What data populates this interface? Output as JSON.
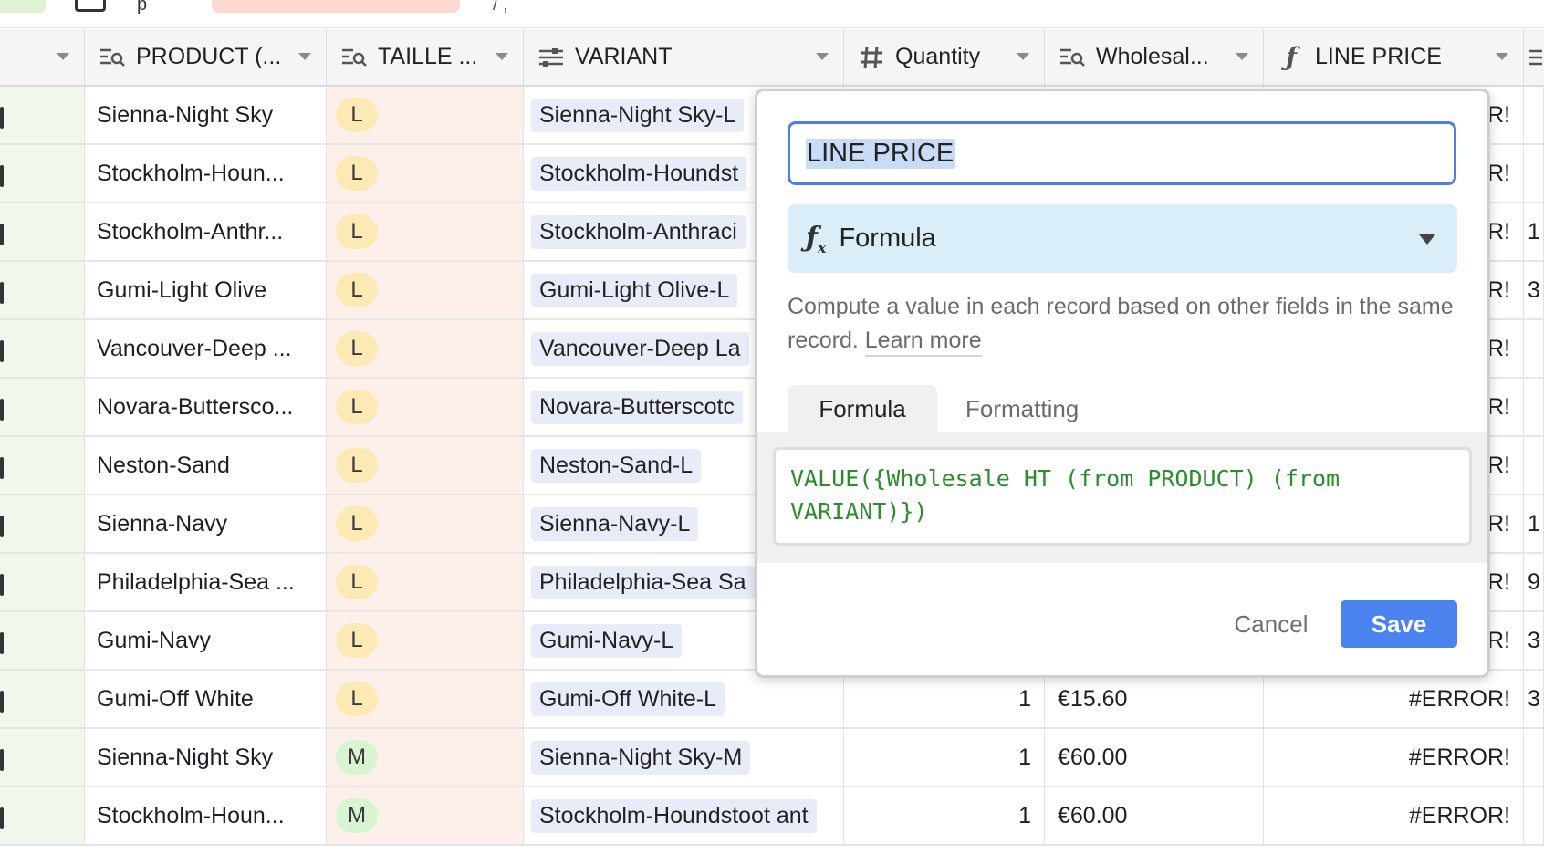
{
  "toolbar": {
    "partial_text_left": "p",
    "partial_text_right": "/ ,"
  },
  "columns": [
    {
      "label": "",
      "icon": ""
    },
    {
      "label": "PRODUCT (...",
      "icon": "lookup-icon"
    },
    {
      "label": "TAILLE ...",
      "icon": "lookup-icon"
    },
    {
      "label": "VARIANT",
      "icon": "link-icon"
    },
    {
      "label": "Quantity",
      "icon": "hash-icon"
    },
    {
      "label": "Wholesal...",
      "icon": "lookup-icon"
    },
    {
      "label": "LINE PRICE",
      "icon": "formula-icon"
    }
  ],
  "rows": [
    {
      "product": "Sienna-Night Sky",
      "size": "L",
      "variant": "Sienna-Night Sky-L",
      "quantity": "",
      "wholesale": "",
      "line_price": "R!",
      "extra": ""
    },
    {
      "product": "Stockholm-Houn...",
      "size": "L",
      "variant": "Stockholm-Houndst",
      "quantity": "",
      "wholesale": "",
      "line_price": "R!",
      "extra": ""
    },
    {
      "product": "Stockholm-Anthr...",
      "size": "L",
      "variant": "Stockholm-Anthraci",
      "quantity": "",
      "wholesale": "",
      "line_price": "R!",
      "extra": "1"
    },
    {
      "product": "Gumi-Light Olive",
      "size": "L",
      "variant": "Gumi-Light Olive-L",
      "quantity": "",
      "wholesale": "",
      "line_price": "R!",
      "extra": "3"
    },
    {
      "product": "Vancouver-Deep ...",
      "size": "L",
      "variant": "Vancouver-Deep La",
      "quantity": "",
      "wholesale": "",
      "line_price": "R!",
      "extra": ""
    },
    {
      "product": "Novara-Buttersco...",
      "size": "L",
      "variant": "Novara-Butterscotc",
      "quantity": "",
      "wholesale": "",
      "line_price": "R!",
      "extra": ""
    },
    {
      "product": "Neston-Sand",
      "size": "L",
      "variant": "Neston-Sand-L",
      "quantity": "",
      "wholesale": "",
      "line_price": "R!",
      "extra": ""
    },
    {
      "product": "Sienna-Navy",
      "size": "L",
      "variant": "Sienna-Navy-L",
      "quantity": "",
      "wholesale": "",
      "line_price": "R!",
      "extra": "1"
    },
    {
      "product": "Philadelphia-Sea ...",
      "size": "L",
      "variant": "Philadelphia-Sea Sa",
      "quantity": "",
      "wholesale": "",
      "line_price": "R!",
      "extra": "9"
    },
    {
      "product": "Gumi-Navy",
      "size": "L",
      "variant": "Gumi-Navy-L",
      "quantity": "",
      "wholesale": "",
      "line_price": "R!",
      "extra": "3"
    },
    {
      "product": "Gumi-Off White",
      "size": "L",
      "variant": "Gumi-Off White-L",
      "quantity": "1",
      "wholesale": "€15.60",
      "line_price": "#ERROR!",
      "extra": "3"
    },
    {
      "product": "Sienna-Night Sky",
      "size": "M",
      "variant": "Sienna-Night Sky-M",
      "quantity": "1",
      "wholesale": "€60.00",
      "line_price": "#ERROR!",
      "extra": ""
    },
    {
      "product": "Stockholm-Houn...",
      "size": "M",
      "variant": "Stockholm-Houndstoot ant",
      "quantity": "1",
      "wholesale": "€60.00",
      "line_price": "#ERROR!",
      "extra": ""
    }
  ],
  "modal": {
    "field_name": "LINE PRICE",
    "field_type": "Formula",
    "description": "Compute a value in each record based on other fields in the same record.",
    "learn_more": "Learn more",
    "tab_formula": "Formula",
    "tab_formatting": "Formatting",
    "formula": "VALUE({Wholesale HT (from PRODUCT) (from VARIANT)})",
    "cancel": "Cancel",
    "save": "Save"
  }
}
